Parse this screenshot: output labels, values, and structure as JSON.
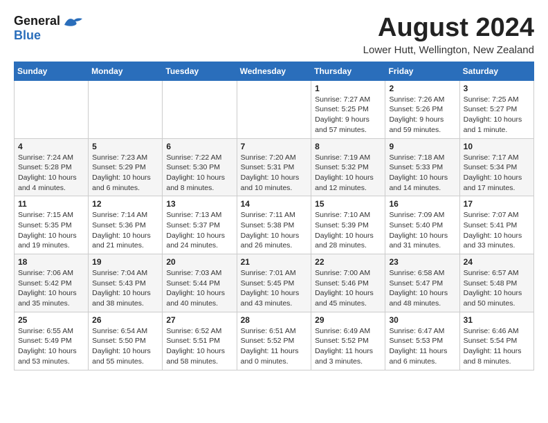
{
  "header": {
    "logo_general": "General",
    "logo_blue": "Blue",
    "month_title": "August 2024",
    "location": "Lower Hutt, Wellington, New Zealand"
  },
  "weekdays": [
    "Sunday",
    "Monday",
    "Tuesday",
    "Wednesday",
    "Thursday",
    "Friday",
    "Saturday"
  ],
  "weeks": [
    [
      {
        "day": "",
        "info": ""
      },
      {
        "day": "",
        "info": ""
      },
      {
        "day": "",
        "info": ""
      },
      {
        "day": "",
        "info": ""
      },
      {
        "day": "1",
        "info": "Sunrise: 7:27 AM\nSunset: 5:25 PM\nDaylight: 9 hours\nand 57 minutes."
      },
      {
        "day": "2",
        "info": "Sunrise: 7:26 AM\nSunset: 5:26 PM\nDaylight: 9 hours\nand 59 minutes."
      },
      {
        "day": "3",
        "info": "Sunrise: 7:25 AM\nSunset: 5:27 PM\nDaylight: 10 hours\nand 1 minute."
      }
    ],
    [
      {
        "day": "4",
        "info": "Sunrise: 7:24 AM\nSunset: 5:28 PM\nDaylight: 10 hours\nand 4 minutes."
      },
      {
        "day": "5",
        "info": "Sunrise: 7:23 AM\nSunset: 5:29 PM\nDaylight: 10 hours\nand 6 minutes."
      },
      {
        "day": "6",
        "info": "Sunrise: 7:22 AM\nSunset: 5:30 PM\nDaylight: 10 hours\nand 8 minutes."
      },
      {
        "day": "7",
        "info": "Sunrise: 7:20 AM\nSunset: 5:31 PM\nDaylight: 10 hours\nand 10 minutes."
      },
      {
        "day": "8",
        "info": "Sunrise: 7:19 AM\nSunset: 5:32 PM\nDaylight: 10 hours\nand 12 minutes."
      },
      {
        "day": "9",
        "info": "Sunrise: 7:18 AM\nSunset: 5:33 PM\nDaylight: 10 hours\nand 14 minutes."
      },
      {
        "day": "10",
        "info": "Sunrise: 7:17 AM\nSunset: 5:34 PM\nDaylight: 10 hours\nand 17 minutes."
      }
    ],
    [
      {
        "day": "11",
        "info": "Sunrise: 7:15 AM\nSunset: 5:35 PM\nDaylight: 10 hours\nand 19 minutes."
      },
      {
        "day": "12",
        "info": "Sunrise: 7:14 AM\nSunset: 5:36 PM\nDaylight: 10 hours\nand 21 minutes."
      },
      {
        "day": "13",
        "info": "Sunrise: 7:13 AM\nSunset: 5:37 PM\nDaylight: 10 hours\nand 24 minutes."
      },
      {
        "day": "14",
        "info": "Sunrise: 7:11 AM\nSunset: 5:38 PM\nDaylight: 10 hours\nand 26 minutes."
      },
      {
        "day": "15",
        "info": "Sunrise: 7:10 AM\nSunset: 5:39 PM\nDaylight: 10 hours\nand 28 minutes."
      },
      {
        "day": "16",
        "info": "Sunrise: 7:09 AM\nSunset: 5:40 PM\nDaylight: 10 hours\nand 31 minutes."
      },
      {
        "day": "17",
        "info": "Sunrise: 7:07 AM\nSunset: 5:41 PM\nDaylight: 10 hours\nand 33 minutes."
      }
    ],
    [
      {
        "day": "18",
        "info": "Sunrise: 7:06 AM\nSunset: 5:42 PM\nDaylight: 10 hours\nand 35 minutes."
      },
      {
        "day": "19",
        "info": "Sunrise: 7:04 AM\nSunset: 5:43 PM\nDaylight: 10 hours\nand 38 minutes."
      },
      {
        "day": "20",
        "info": "Sunrise: 7:03 AM\nSunset: 5:44 PM\nDaylight: 10 hours\nand 40 minutes."
      },
      {
        "day": "21",
        "info": "Sunrise: 7:01 AM\nSunset: 5:45 PM\nDaylight: 10 hours\nand 43 minutes."
      },
      {
        "day": "22",
        "info": "Sunrise: 7:00 AM\nSunset: 5:46 PM\nDaylight: 10 hours\nand 45 minutes."
      },
      {
        "day": "23",
        "info": "Sunrise: 6:58 AM\nSunset: 5:47 PM\nDaylight: 10 hours\nand 48 minutes."
      },
      {
        "day": "24",
        "info": "Sunrise: 6:57 AM\nSunset: 5:48 PM\nDaylight: 10 hours\nand 50 minutes."
      }
    ],
    [
      {
        "day": "25",
        "info": "Sunrise: 6:55 AM\nSunset: 5:49 PM\nDaylight: 10 hours\nand 53 minutes."
      },
      {
        "day": "26",
        "info": "Sunrise: 6:54 AM\nSunset: 5:50 PM\nDaylight: 10 hours\nand 55 minutes."
      },
      {
        "day": "27",
        "info": "Sunrise: 6:52 AM\nSunset: 5:51 PM\nDaylight: 10 hours\nand 58 minutes."
      },
      {
        "day": "28",
        "info": "Sunrise: 6:51 AM\nSunset: 5:52 PM\nDaylight: 11 hours\nand 0 minutes."
      },
      {
        "day": "29",
        "info": "Sunrise: 6:49 AM\nSunset: 5:52 PM\nDaylight: 11 hours\nand 3 minutes."
      },
      {
        "day": "30",
        "info": "Sunrise: 6:47 AM\nSunset: 5:53 PM\nDaylight: 11 hours\nand 6 minutes."
      },
      {
        "day": "31",
        "info": "Sunrise: 6:46 AM\nSunset: 5:54 PM\nDaylight: 11 hours\nand 8 minutes."
      }
    ]
  ]
}
